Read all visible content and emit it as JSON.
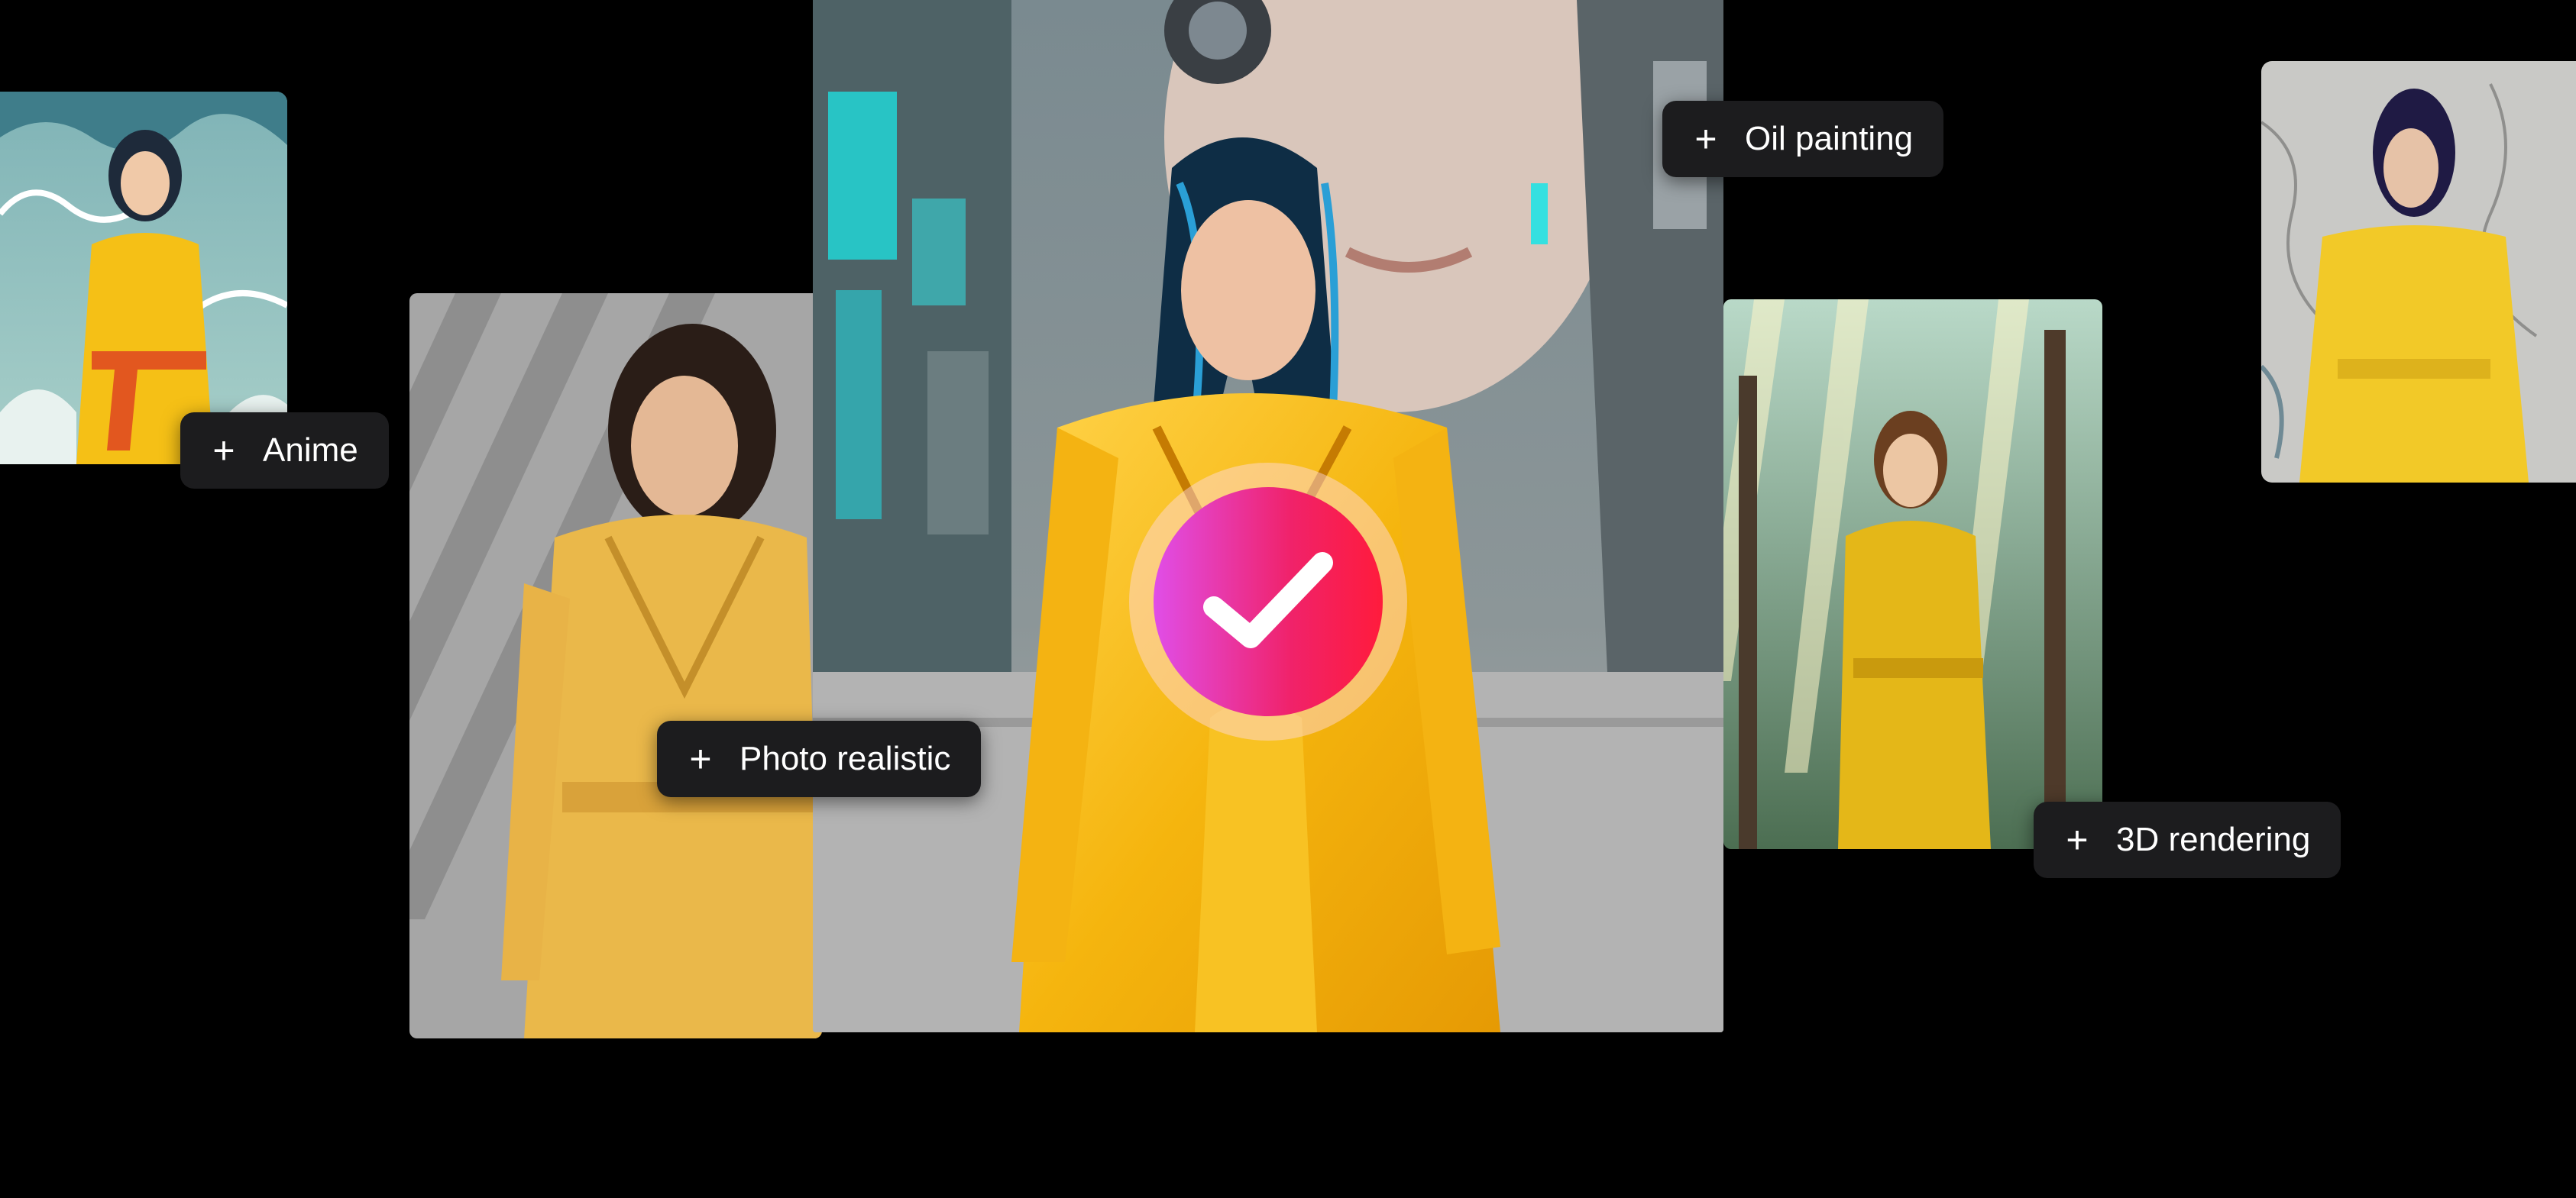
{
  "tags": {
    "anime": "Anime",
    "photo_realistic": "Photo realistic",
    "oil_painting": "Oil painting",
    "rendering_3d": "3D rendering",
    "plus_glyph": "+"
  },
  "colors": {
    "background": "#000000",
    "tag_background": "#1c1c1e",
    "tag_text": "#ffffff",
    "check_gradient_start": "#e04ee8",
    "check_gradient_end": "#ff1b3c",
    "dress_yellow": "#f5c016"
  },
  "icons": {
    "plus": "plus-icon",
    "check": "checkmark-icon"
  }
}
